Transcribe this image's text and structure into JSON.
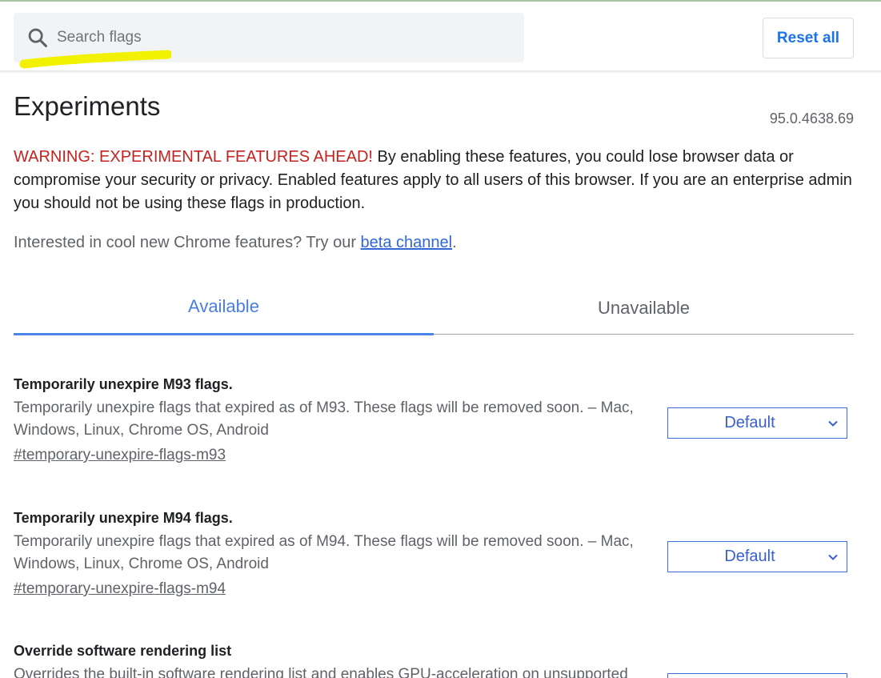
{
  "header": {
    "search": {
      "placeholder": "Search flags",
      "value": ""
    },
    "reset_label": "Reset all"
  },
  "page": {
    "title": "Experiments",
    "version": "95.0.4638.69",
    "warning_prefix": "WARNING: EXPERIMENTAL FEATURES AHEAD!",
    "warning_text": " By enabling these features, you could lose browser data or compromise your security or privacy. Enabled features apply to all users of this browser. If you are an enterprise admin you should not be using these flags in production.",
    "interest_text": "Interested in cool new Chrome features? Try our ",
    "beta_link": "beta channel",
    "interest_suffix": "."
  },
  "tabs": [
    {
      "label": "Available",
      "selected": true
    },
    {
      "label": "Unavailable",
      "selected": false
    }
  ],
  "flags": [
    {
      "title": "Temporarily unexpire M93 flags.",
      "description": "Temporarily unexpire flags that expired as of M93. These flags will be removed soon. – Mac, Windows, Linux, Chrome OS, Android",
      "link": "#temporary-unexpire-flags-m93",
      "value": "Default"
    },
    {
      "title": "Temporarily unexpire M94 flags.",
      "description": "Temporarily unexpire flags that expired as of M94. These flags will be removed soon. – Mac, Windows, Linux, Chrome OS, Android",
      "link": "#temporary-unexpire-flags-m94",
      "value": "Default"
    },
    {
      "title": "Override software rendering list",
      "description": "Overrides the built-in software rendering list and enables GPU-acceleration on unsupported",
      "link": "",
      "value": ""
    }
  ],
  "colors": {
    "accent": "#1a73e8",
    "warning": "#c5221f",
    "tab_selected": "#4a7ee0",
    "highlight": "#f2f200"
  },
  "icons": {
    "search": "search-icon",
    "dropdown": "chevron-down-icon",
    "annotation": "highlighter-mark"
  }
}
